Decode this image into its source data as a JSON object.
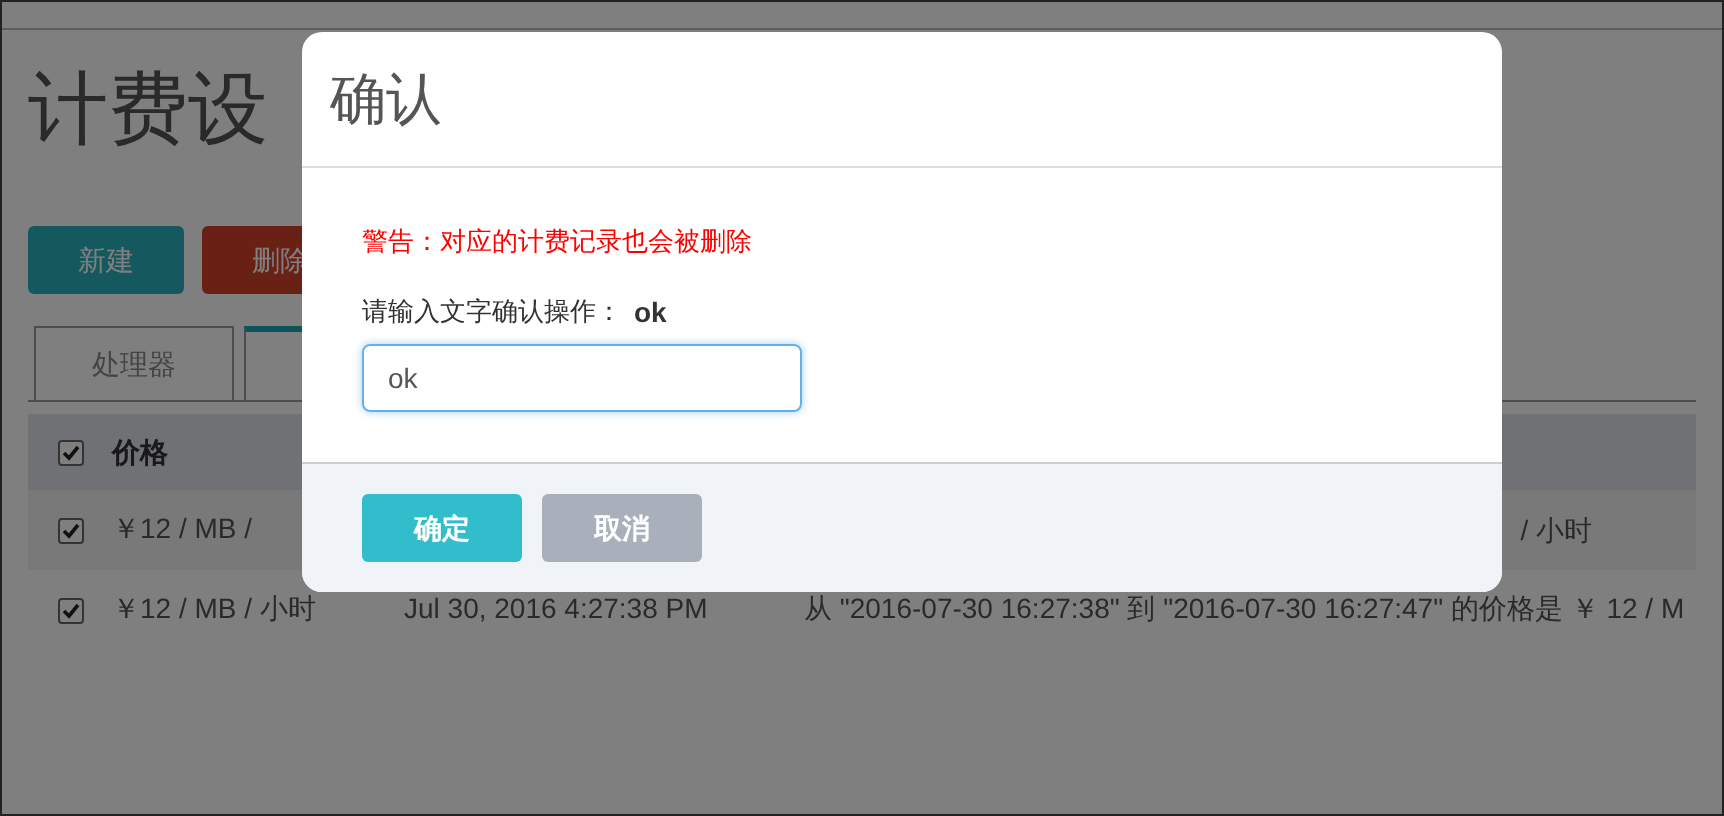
{
  "page": {
    "title": "计费设",
    "buttons": [
      {
        "label": "新建",
        "kind": "primary"
      },
      {
        "label": "删除",
        "kind": "danger"
      }
    ],
    "tabs": [
      {
        "label": "处理器",
        "selected": false
      },
      {
        "selected": true
      }
    ],
    "table": {
      "header": {
        "checked": true,
        "columns": [
          "价格"
        ]
      },
      "rows": [
        {
          "checked": true,
          "cells": [
            "￥12 / MB /"
          ],
          "tail": "/ 小时"
        },
        {
          "checked": true,
          "cells": [
            "￥12 / MB / 小时",
            "Jul 30, 2016 4:27:38 PM",
            "从 \"2016-07-30 16:27:38\" 到 \"2016-07-30 16:27:47\" 的价格是 ￥ 12 / M"
          ]
        }
      ]
    }
  },
  "dialog": {
    "title": "确认",
    "warning": "警告：对应的计费记录也会被删除",
    "prompt": "请输入文字确认操作：",
    "keyword": "ok",
    "input": {
      "value": "ok"
    },
    "buttons": [
      {
        "label": "确定",
        "kind": "primary"
      },
      {
        "label": "取消",
        "kind": "secondary"
      }
    ]
  }
}
